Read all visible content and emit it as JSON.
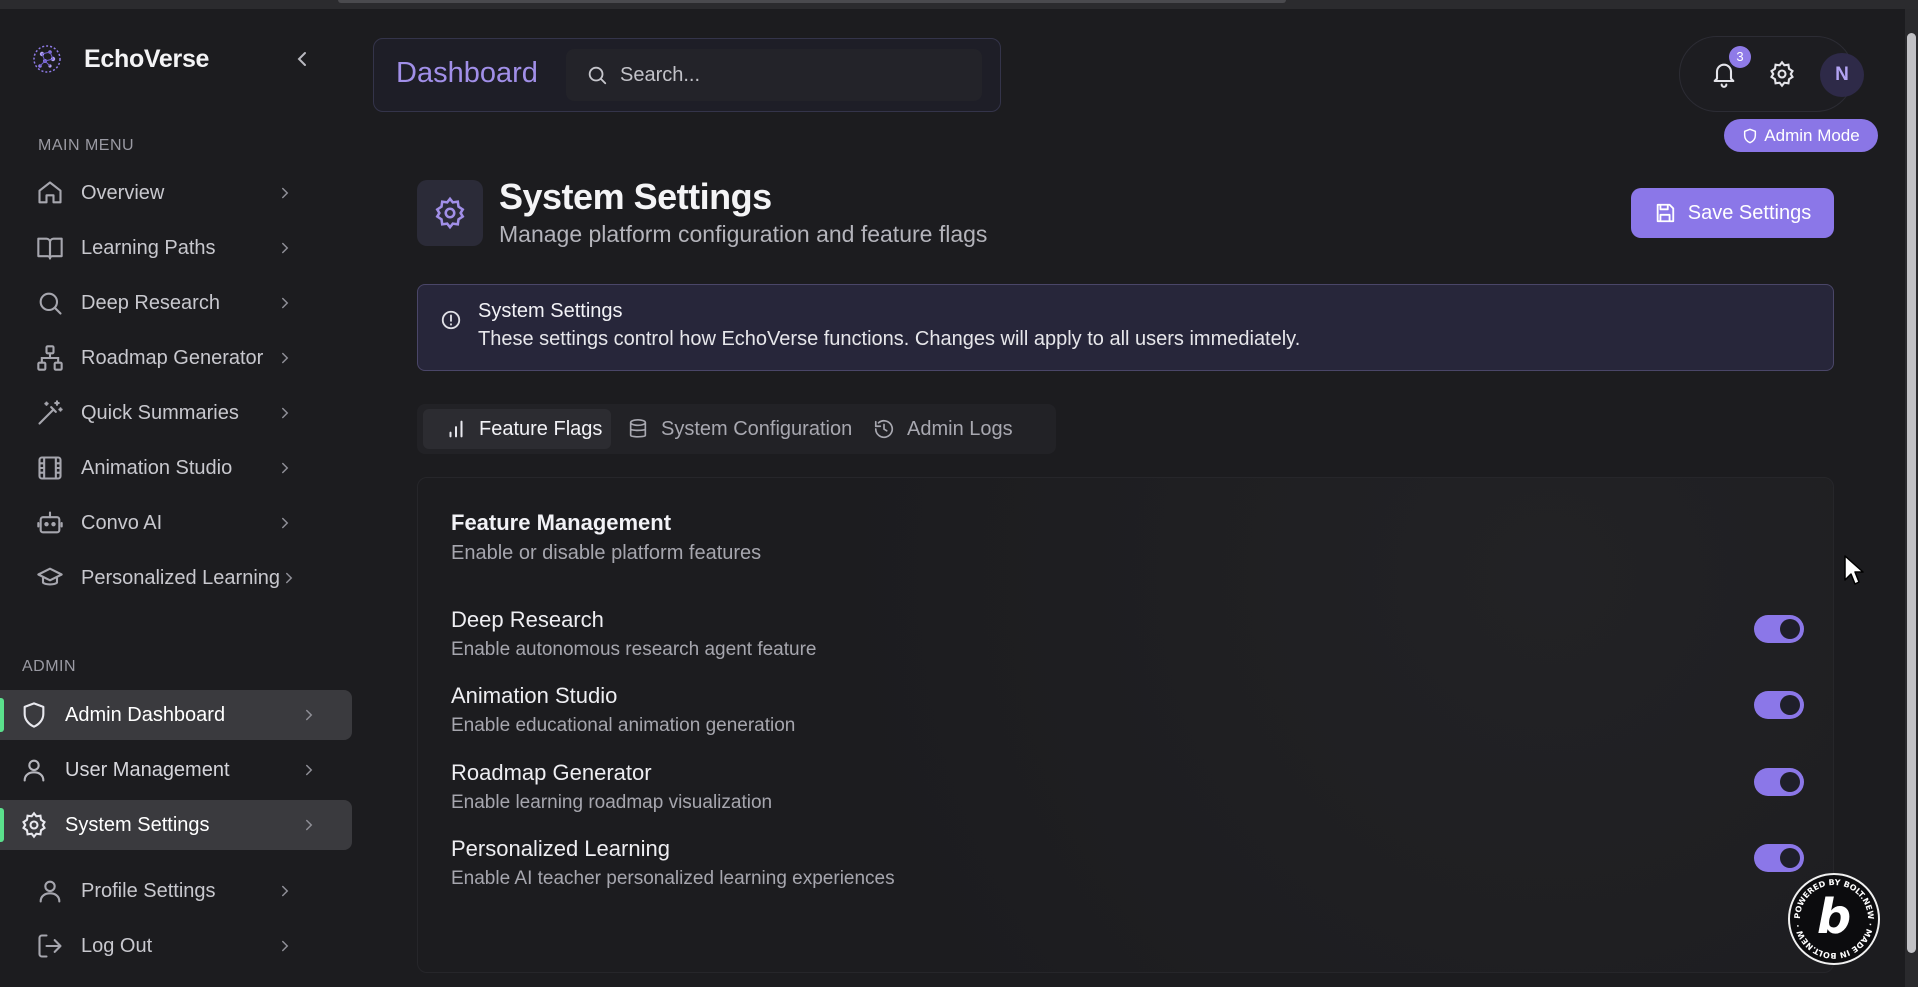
{
  "brand": {
    "name": "EchoVerse"
  },
  "sidebar": {
    "main_label": "MAIN MENU",
    "main_items": [
      {
        "label": "Overview",
        "icon": "home-icon"
      },
      {
        "label": "Learning Paths",
        "icon": "book-icon"
      },
      {
        "label": "Deep Research",
        "icon": "search-icon"
      },
      {
        "label": "Roadmap Generator",
        "icon": "network-icon"
      },
      {
        "label": "Quick Summaries",
        "icon": "wand-icon"
      },
      {
        "label": "Animation Studio",
        "icon": "film-icon"
      },
      {
        "label": "Convo AI",
        "icon": "bot-icon"
      },
      {
        "label": "Personalized Learning",
        "icon": "graduation-cap-icon"
      }
    ],
    "admin_label": "ADMIN",
    "admin_items": [
      {
        "label": "Admin Dashboard",
        "icon": "shield-icon",
        "active": true
      },
      {
        "label": "User Management",
        "icon": "user-icon",
        "active": false
      },
      {
        "label": "System Settings",
        "icon": "gear-icon",
        "active": true
      }
    ],
    "bottom_items": [
      {
        "label": "Profile Settings",
        "icon": "user-icon"
      },
      {
        "label": "Log Out",
        "icon": "logout-icon"
      }
    ]
  },
  "header": {
    "title": "Dashboard",
    "search_placeholder": "Search...",
    "notification_count": "3",
    "avatar_initial": "N",
    "admin_mode_label": "Admin Mode"
  },
  "page": {
    "title": "System Settings",
    "subtitle": "Manage platform configuration and feature flags",
    "save_label": "Save Settings"
  },
  "alert": {
    "title": "System Settings",
    "description": "These settings control how EchoVerse functions. Changes will apply to all users immediately."
  },
  "tabs": [
    {
      "label": "Feature Flags",
      "icon": "bar-chart-icon",
      "active": true
    },
    {
      "label": "System Configuration",
      "icon": "database-icon",
      "active": false
    },
    {
      "label": "Admin Logs",
      "icon": "history-icon",
      "active": false
    }
  ],
  "features": {
    "title": "Feature Management",
    "subtitle": "Enable or disable platform features",
    "items": [
      {
        "name": "Deep Research",
        "description": "Enable autonomous research agent feature",
        "enabled": true
      },
      {
        "name": "Animation Studio",
        "description": "Enable educational animation generation",
        "enabled": true
      },
      {
        "name": "Roadmap Generator",
        "description": "Enable learning roadmap visualization",
        "enabled": true
      },
      {
        "name": "Personalized Learning",
        "description": "Enable AI teacher personalized learning experiences",
        "enabled": true
      }
    ]
  },
  "bolt_badge": {
    "letter": "b",
    "ring_text": "POWERED BY BOLT.NEW · MADE IN BOLT.NEW ·"
  },
  "colors": {
    "accent": "#8b77e8",
    "active_indicator": "#5be08c",
    "background": "#1c1c1f"
  }
}
